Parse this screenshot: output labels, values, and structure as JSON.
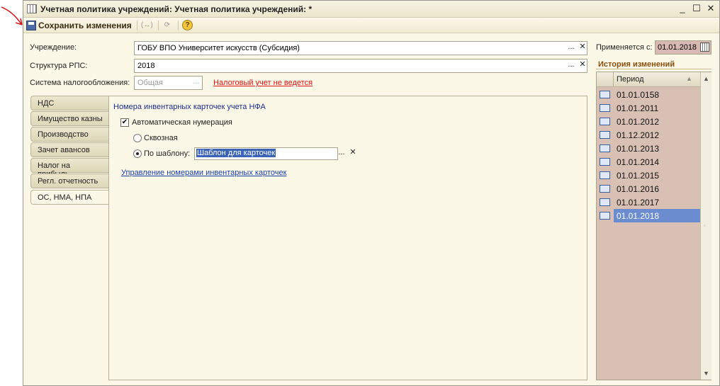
{
  "window": {
    "title": "Учетная политика учреждений: Учетная политика учреждений: *"
  },
  "toolbar": {
    "save_label": "Сохранить изменения",
    "help_label": "?"
  },
  "form": {
    "institution_label": "Учреждение:",
    "institution_value": "ГОБУ ВПО Университет искусств (Субсидия)",
    "rps_label": "Структура РПС:",
    "rps_value": "2018",
    "tax_label": "Система налогообложения:",
    "tax_value": "Общая",
    "tax_link": "Налоговый учет не ведется",
    "applied_label": "Применяется с:",
    "applied_value": "01.01.2018"
  },
  "tabs": [
    {
      "label": "НДС"
    },
    {
      "label": "Имущество казны"
    },
    {
      "label": "Производство"
    },
    {
      "label": "Зачет авансов"
    },
    {
      "label": "Налог на прибыль"
    },
    {
      "label": "Регл. отчетность"
    },
    {
      "label": "ОС, НМА, НПА"
    }
  ],
  "panel": {
    "section_title": "Номера инвентарных карточек учета НФА",
    "auto_numbering": "Автоматическая нумерация",
    "radio_through": "Сквозная",
    "radio_template": "По шаблону:",
    "template_value": "Шаблон для карточек",
    "manage_link": "Управление номерами инвентарных карточек"
  },
  "history": {
    "title": "История изменений",
    "column": "Период",
    "rows": [
      "01.01.0158",
      "01.01.2011",
      "01.01.2012",
      "01.12.2012",
      "01.01.2013",
      "01.01.2014",
      "01.01.2015",
      "01.01.2016",
      "01.01.2017",
      "01.01.2018"
    ],
    "selected": "01.01.2018"
  },
  "colors": {
    "accent": "#6b8ccf",
    "grid_bg": "#d8c0b4",
    "link_red": "#dd1111",
    "link_blue": "#1a3fa8"
  }
}
